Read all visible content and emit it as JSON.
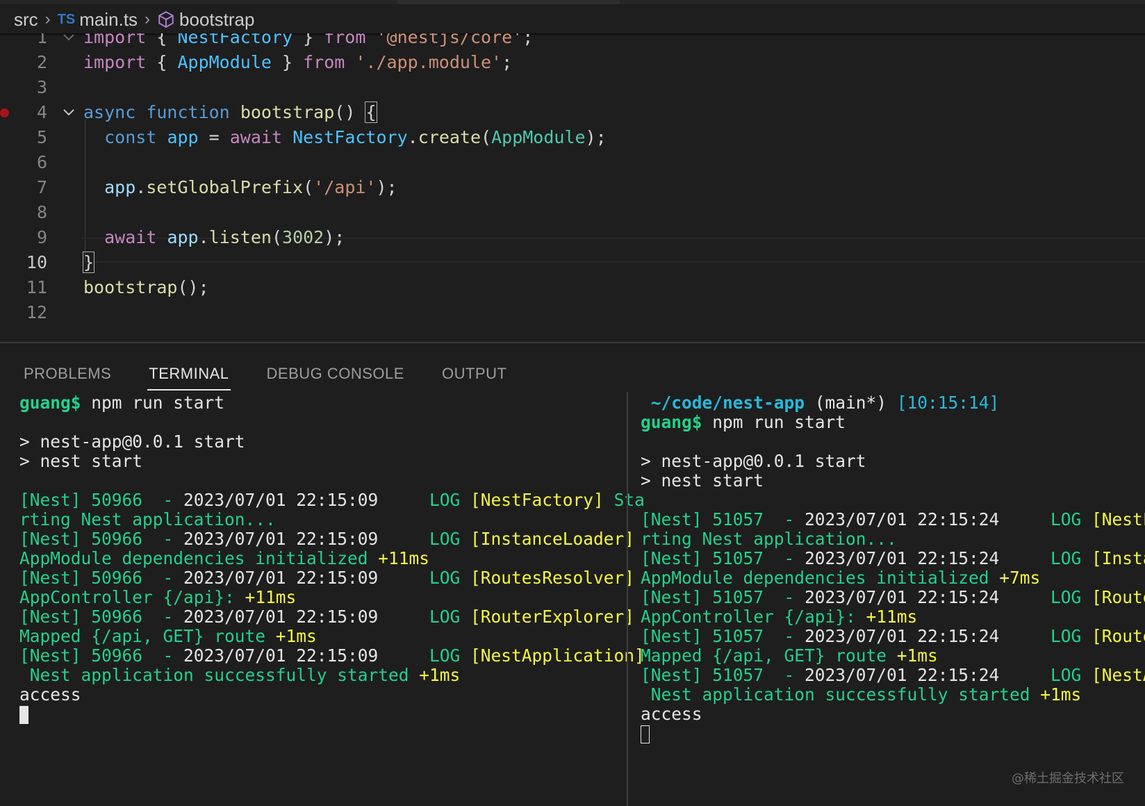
{
  "breadcrumb": {
    "folder": "src",
    "file_icon": "TS",
    "file": "main.ts",
    "symbol": "bootstrap"
  },
  "editor": {
    "line_numbers": [
      "1",
      "2",
      "3",
      "4",
      "5",
      "6",
      "7",
      "8",
      "9",
      "10",
      "11",
      "12"
    ],
    "active_line": "10",
    "lines": [
      [
        [
          "kw",
          "import"
        ],
        [
          "p",
          " { "
        ],
        [
          "vc",
          "NestFactory"
        ],
        [
          "p",
          " } "
        ],
        [
          "kw",
          "from"
        ],
        [
          "p",
          " "
        ],
        [
          "s",
          "'@nestjs/core'"
        ],
        [
          "p",
          ";"
        ]
      ],
      [
        [
          "kw",
          "import"
        ],
        [
          "p",
          " { "
        ],
        [
          "vc",
          "AppModule"
        ],
        [
          "p",
          " } "
        ],
        [
          "kw",
          "from"
        ],
        [
          "p",
          " "
        ],
        [
          "s",
          "'./app.module'"
        ],
        [
          "p",
          ";"
        ]
      ],
      [],
      [
        [
          "st",
          "async"
        ],
        [
          "p",
          " "
        ],
        [
          "st",
          "function"
        ],
        [
          "p",
          " "
        ],
        [
          "fn",
          "bootstrap"
        ],
        [
          "p",
          "() "
        ],
        [
          "brk",
          "{"
        ]
      ],
      [
        [
          "p",
          "  "
        ],
        [
          "st",
          "const"
        ],
        [
          "p",
          " "
        ],
        [
          "vc",
          "app"
        ],
        [
          "p",
          " = "
        ],
        [
          "kw",
          "await"
        ],
        [
          "p",
          " "
        ],
        [
          "vc",
          "NestFactory"
        ],
        [
          "p",
          "."
        ],
        [
          "fn",
          "create"
        ],
        [
          "p",
          "("
        ],
        [
          "ty",
          "AppModule"
        ],
        [
          "p",
          ");"
        ]
      ],
      [],
      [
        [
          "p",
          "  "
        ],
        [
          "vr",
          "app"
        ],
        [
          "p",
          "."
        ],
        [
          "fn",
          "setGlobalPrefix"
        ],
        [
          "p",
          "("
        ],
        [
          "s",
          "'/api'"
        ],
        [
          "p",
          ");"
        ]
      ],
      [],
      [
        [
          "p",
          "  "
        ],
        [
          "kw",
          "await"
        ],
        [
          "p",
          " "
        ],
        [
          "vr",
          "app"
        ],
        [
          "p",
          "."
        ],
        [
          "fn",
          "listen"
        ],
        [
          "p",
          "("
        ],
        [
          "n",
          "3002"
        ],
        [
          "p",
          ");"
        ]
      ],
      [
        [
          "brk",
          "}"
        ]
      ],
      [
        [
          "fn",
          "bootstrap"
        ],
        [
          "p",
          "();"
        ]
      ],
      []
    ]
  },
  "panel": {
    "tabs": [
      "PROBLEMS",
      "TERMINAL",
      "DEBUG CONSOLE",
      "OUTPUT"
    ],
    "active_tab": "TERMINAL"
  },
  "terminal_left": [
    [
      [
        "gb",
        "guang$"
      ],
      [
        "p",
        " npm run start"
      ]
    ],
    [],
    [
      [
        "p",
        "> nest-app@0.0.1 start"
      ]
    ],
    [
      [
        "p",
        "> nest start"
      ]
    ],
    [],
    [
      [
        "g",
        "[Nest] 50966  - "
      ],
      [
        "p",
        "2023/07/01 22:15:09"
      ],
      [
        "g",
        "     LOG "
      ],
      [
        "y",
        "[NestFactory]"
      ],
      [
        "g",
        " Sta"
      ]
    ],
    [
      [
        "g",
        "rting Nest application..."
      ]
    ],
    [
      [
        "g",
        "[Nest] 50966  - "
      ],
      [
        "p",
        "2023/07/01 22:15:09"
      ],
      [
        "g",
        "     LOG "
      ],
      [
        "y",
        "[InstanceLoader]"
      ]
    ],
    [
      [
        "g",
        "AppModule dependencies initialized "
      ],
      [
        "y",
        "+11ms"
      ]
    ],
    [
      [
        "g",
        "[Nest] 50966  - "
      ],
      [
        "p",
        "2023/07/01 22:15:09"
      ],
      [
        "g",
        "     LOG "
      ],
      [
        "y",
        "[RoutesResolver]"
      ]
    ],
    [
      [
        "g",
        "AppController {/api}: "
      ],
      [
        "y",
        "+11ms"
      ]
    ],
    [
      [
        "g",
        "[Nest] 50966  - "
      ],
      [
        "p",
        "2023/07/01 22:15:09"
      ],
      [
        "g",
        "     LOG "
      ],
      [
        "y",
        "[RouterExplorer]"
      ]
    ],
    [
      [
        "g",
        "Mapped {/api, GET} route "
      ],
      [
        "y",
        "+1ms"
      ]
    ],
    [
      [
        "g",
        "[Nest] 50966  - "
      ],
      [
        "p",
        "2023/07/01 22:15:09"
      ],
      [
        "g",
        "     LOG "
      ],
      [
        "y",
        "[NestApplication]"
      ]
    ],
    [
      [
        "g",
        " Nest application successfully started "
      ],
      [
        "y",
        "+1ms"
      ]
    ],
    [
      [
        "p",
        "access"
      ]
    ],
    [
      [
        "cursor",
        "solid"
      ]
    ]
  ],
  "terminal_right": [
    [
      [
        "p",
        " "
      ],
      [
        "cb",
        "~/code/nest-app"
      ],
      [
        "p",
        " (main*) "
      ],
      [
        "c",
        "[10:15:14]"
      ]
    ],
    [
      [
        "gb",
        "guang$"
      ],
      [
        "p",
        " npm run start"
      ]
    ],
    [],
    [
      [
        "p",
        "> nest-app@0.0.1 start"
      ]
    ],
    [
      [
        "p",
        "> nest start"
      ]
    ],
    [],
    [
      [
        "g",
        "[Nest] 51057  - "
      ],
      [
        "p",
        "2023/07/01 22:15:24"
      ],
      [
        "g",
        "     LOG "
      ],
      [
        "y",
        "[NestFac"
      ]
    ],
    [
      [
        "g",
        "rting Nest application..."
      ]
    ],
    [
      [
        "g",
        "[Nest] 51057  - "
      ],
      [
        "p",
        "2023/07/01 22:15:24"
      ],
      [
        "g",
        "     LOG "
      ],
      [
        "y",
        "[Instanc"
      ]
    ],
    [
      [
        "g",
        "AppModule dependencies initialized "
      ],
      [
        "y",
        "+7ms"
      ]
    ],
    [
      [
        "g",
        "[Nest] 51057  - "
      ],
      [
        "p",
        "2023/07/01 22:15:24"
      ],
      [
        "g",
        "     LOG "
      ],
      [
        "y",
        "[RoutesR"
      ]
    ],
    [
      [
        "g",
        "AppController {/api}: "
      ],
      [
        "y",
        "+11ms"
      ]
    ],
    [
      [
        "g",
        "[Nest] 51057  - "
      ],
      [
        "p",
        "2023/07/01 22:15:24"
      ],
      [
        "g",
        "     LOG "
      ],
      [
        "y",
        "[RouterE"
      ]
    ],
    [
      [
        "g",
        "Mapped {/api, GET} route "
      ],
      [
        "y",
        "+1ms"
      ]
    ],
    [
      [
        "g",
        "[Nest] 51057  - "
      ],
      [
        "p",
        "2023/07/01 22:15:24"
      ],
      [
        "g",
        "     LOG "
      ],
      [
        "y",
        "[NestApp"
      ]
    ],
    [
      [
        "g",
        " Nest application successfully started "
      ],
      [
        "y",
        "+1ms"
      ]
    ],
    [
      [
        "p",
        "access"
      ]
    ],
    [
      [
        "cursor",
        "hollow"
      ]
    ]
  ],
  "watermark": "@稀土掘金技术社区"
}
